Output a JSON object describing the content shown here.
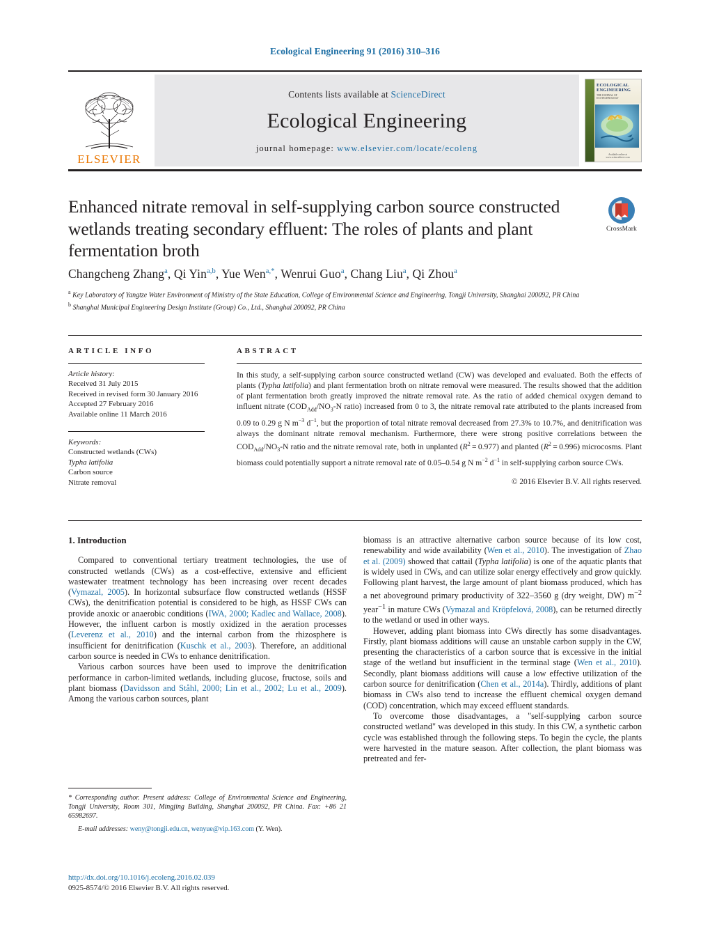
{
  "running_head": "Ecological Engineering 91 (2016) 310–316",
  "masthead": {
    "contents_prefix": "Contents lists available at ",
    "contents_link": "ScienceDirect",
    "journal_name": "Ecological Engineering",
    "homepage_prefix": "journal homepage: ",
    "homepage_url": "www.elsevier.com/locate/ecoleng",
    "publisher_name": "ELSEVIER",
    "cover": {
      "title_line1": "ECOLOGICAL",
      "title_line2": "ENGINEERING",
      "subtitle": "THE JOURNAL OF ECOTECHNOLOGY",
      "footer": "Available online at\nwww.sciencedirect.com"
    }
  },
  "article": {
    "title": "Enhanced nitrate removal in self-supplying carbon source constructed wetlands treating secondary effluent: The roles of plants and plant fermentation broth",
    "crossmark_label": "CrossMark",
    "authors_html": "Changcheng Zhang<sup>a</sup>, Qi Yin<sup>a,b</sup>, Yue Wen<sup>a,</sup><sup class=\"star\">*</sup>, Wenrui Guo<sup>a</sup>, Chang Liu<sup>a</sup>, Qi Zhou<sup>a</sup>",
    "authors_plain": "Changcheng Zhang, Qi Yin, Yue Wen, Wenrui Guo, Chang Liu, Qi Zhou",
    "affiliation_a": "Key Laboratory of Yangtze Water Environment of Ministry of the State Education, College of Environmental Science and Engineering, Tongji University, Shanghai 200092, PR China",
    "affiliation_b": "Shanghai Municipal Engineering Design Institute (Group) Co., Ltd., Shanghai 200092, PR China"
  },
  "info": {
    "heading": "ARTICLE INFO",
    "history_label": "Article history:",
    "history": [
      "Received 31 July 2015",
      "Received in revised form 30 January 2016",
      "Accepted 27 February 2016",
      "Available online 11 March 2016"
    ],
    "keywords_label": "Keywords:",
    "keywords": [
      "Constructed wetlands (CWs)",
      "Typha latifolia",
      "Carbon source",
      "Nitrate removal"
    ]
  },
  "abstract": {
    "heading": "ABSTRACT",
    "text_html": "In this study, a self-supplying carbon source constructed wetland (CW) was developed and evaluated. Both the effects of plants (<span class=\"ital\">Typha latifolia</span>) and plant fermentation broth on nitrate removal were measured. The results showed that the addition of plant fermentation broth greatly improved the nitrate removal rate. As the ratio of added chemical oxygen demand to influent nitrate (COD<sub>Add</sub>/NO<sub>3</sub>-N ratio) increased from 0 to 3, the nitrate removal rate attributed to the plants increased from 0.09 to 0.29 g N m<sup>−3</sup> d<sup>−1</sup>, but the proportion of total nitrate removal decreased from 27.3% to 10.7%, and denitrification was always the dominant nitrate removal mechanism. Furthermore, there were strong positive correlations between the COD<sub>Add</sub>/NO<sub>3</sub>-N ratio and the nitrate removal rate, both in unplanted (<span class=\"ital\">R</span><sup>2</sup>&#8239;=&#8239;0.977) and planted (<span class=\"ital\">R</span><sup>2</sup>&#8239;=&#8239;0.996) microcosms. Plant biomass could potentially support a nitrate removal rate of 0.05–0.54 g N m<sup>−2</sup> d<sup>−1</sup> in self-supplying carbon source CWs.",
    "copyright": "© 2016 Elsevier B.V. All rights reserved."
  },
  "body": {
    "section_number_title": "1. Introduction",
    "left_paragraphs_html": [
      "Compared to conventional tertiary treatment technologies, the use of constructed wetlands (CWs) as a cost-effective, extensive and efficient wastewater treatment technology has been increasing over recent decades (<span class=\"ref\">Vymazal, 2005</span>). In horizontal subsurface flow constructed wetlands (HSSF CWs), the denitrification potential is considered to be high, as HSSF CWs can provide anoxic or anaerobic conditions (<span class=\"ref\">IWA, 2000; Kadlec and Wallace, 2008</span>). However, the influent carbon is mostly oxidized in the aeration processes (<span class=\"ref\">Leverenz et al., 2010</span>) and the internal carbon from the rhizosphere is insufficient for denitrification (<span class=\"ref\">Kuschk et al., 2003</span>). Therefore, an additional carbon source is needed in CWs to enhance denitrification.",
      "Various carbon sources have been used to improve the denitrification performance in carbon-limited wetlands, including glucose, fructose, soils and plant biomass (<span class=\"ref\">Davidsson and Ståhl, 2000; Lin et al., 2002; Lu et al., 2009</span>). Among the various carbon sources, plant"
    ],
    "right_paragraphs_html": [
      "biomass is an attractive alternative carbon source because of its low cost, renewability and wide availability (<span class=\"ref\">Wen et al., 2010</span>). The investigation of <span class=\"ref\">Zhao et al. (2009)</span> showed that cattail (<span class=\"ital\">Typha latifolia</span>) is one of the aquatic plants that is widely used in CWs, and can utilize solar energy effectively and grow quickly. Following plant harvest, the large amount of plant biomass produced, which has a net aboveground primary productivity of 322–3560 g (dry weight, DW) m<sup>−2</sup> year<sup>−1</sup> in mature CWs (<span class=\"ref\">Vymazal and Kröpfelová, 2008</span>), can be returned directly to the wetland or used in other ways.",
      "However, adding plant biomass into CWs directly has some disadvantages. Firstly, plant biomass additions will cause an unstable carbon supply in the CW, presenting the characteristics of a carbon source that is excessive in the initial stage of the wetland but insufficient in the terminal stage (<span class=\"ref\">Wen et al., 2010</span>). Secondly, plant biomass additions will cause a low effective utilization of the carbon source for denitrification (<span class=\"ref\">Chen et al., 2014a</span>). Thirdly, additions of plant biomass in CWs also tend to increase the effluent chemical oxygen demand (COD) concentration, which may exceed effluent standards.",
      "To overcome those disadvantages, a \"self-supplying carbon source constructed wetland\" was developed in this study. In this CW, a synthetic carbon cycle was established through the following steps. To begin the cycle, the plants were harvested in the mature season. After collection, the plant biomass was pretreated and fer-"
    ]
  },
  "footnote": {
    "corresponding_html": "<span class=\"ital\">* Corresponding author. Present address: College of Environmental Science and Engineering, Tongji University, Room 301, Mingjing Building, Shanghai 200092, PR China. Fax: +86 21 65982697.</span>",
    "email_label": "E-mail addresses:",
    "email_1": "weny@tongji.edu.cn",
    "email_2": "wenyue@vip.163.com",
    "email_suffix": "(Y. Wen)."
  },
  "doi": {
    "url": "http://dx.doi.org/10.1016/j.ecoleng.2016.02.039",
    "issn_line": "0925-8574/© 2016 Elsevier B.V. All rights reserved."
  }
}
